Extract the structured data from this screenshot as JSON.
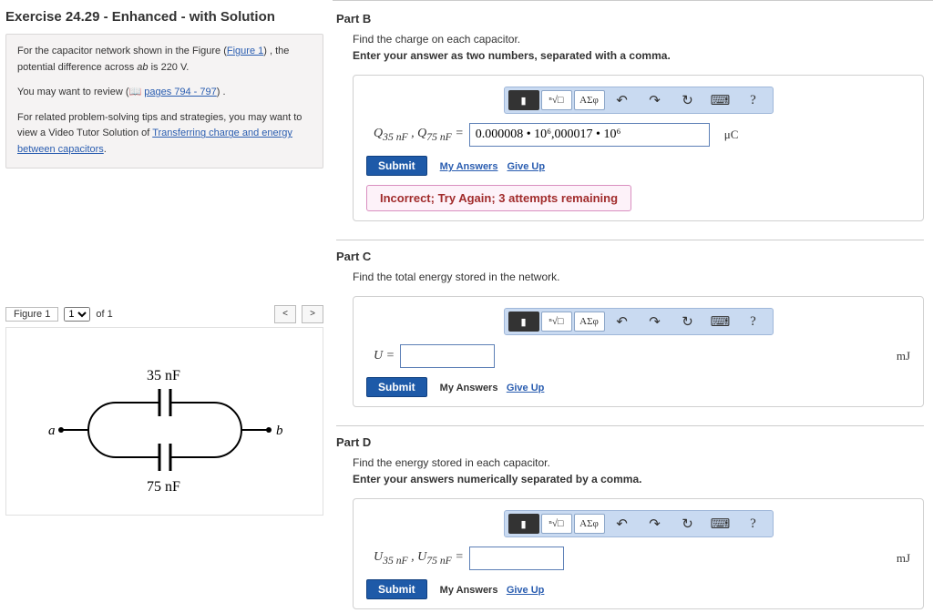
{
  "exercise": {
    "title": "Exercise 24.29 - Enhanced - with Solution",
    "intro_1a": "For the capacitor network shown in the Figure (",
    "intro_1_link": "Figure 1",
    "intro_1b": ") , the potential difference across ",
    "intro_var": "ab",
    "intro_1c": " is 220 V.",
    "review_pre": "You may want to review (",
    "review_icon": "📖",
    "review_link": "pages 794 - 797",
    "review_post": ") .",
    "related_pre": "For related problem-solving tips and strategies, you may want to view a Video Tutor Solution of ",
    "related_link": "Transferring charge and energy between capacitors",
    "related_post": "."
  },
  "figure": {
    "label": "Figure 1",
    "of": "of 1",
    "cap_top": "35 nF",
    "cap_bot": "75 nF",
    "node_a": "a",
    "node_b": "b"
  },
  "toolbar": {
    "template": "▮",
    "root": "ⁿ√□",
    "greek": "ΑΣφ",
    "undo": "↶",
    "redo": "↷",
    "reset": "↻",
    "keyboard": "⌨",
    "help": "?"
  },
  "common": {
    "submit": "Submit",
    "my_answers": "My Answers",
    "give_up": "Give Up"
  },
  "partB": {
    "heading": "Part B",
    "prompt": "Find the charge on each capacitor.",
    "instr": "Enter your answer as two numbers, separated with a comma.",
    "lhs_html": "Q<sub>35 nF</sub> , Q<sub>75 nF</sub> =",
    "value": "0.000008 • 10⁶,000017 • 10⁶",
    "unit": "μC",
    "feedback": "Incorrect; Try Again; 3 attempts remaining"
  },
  "partC": {
    "heading": "Part C",
    "prompt": "Find the total energy stored in the network.",
    "lhs": "U =",
    "value": "",
    "unit": "mJ"
  },
  "partD": {
    "heading": "Part D",
    "prompt": "Find the energy stored in each capacitor.",
    "instr": "Enter your answers numerically separated by a comma.",
    "lhs_html": "U<sub>35 nF</sub> , U<sub>75 nF</sub> =",
    "value": "",
    "unit": "mJ"
  }
}
